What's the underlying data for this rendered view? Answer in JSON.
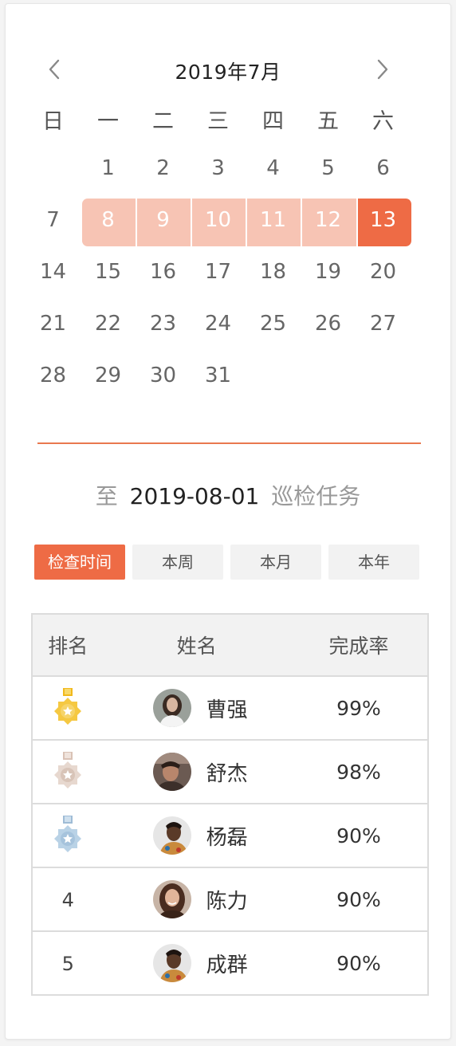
{
  "calendar": {
    "title": "2019年7月",
    "weekdays": [
      "日",
      "一",
      "二",
      "三",
      "四",
      "五",
      "六"
    ],
    "days": [
      "1",
      "2",
      "3",
      "4",
      "5",
      "6",
      "7",
      "8",
      "9",
      "10",
      "11",
      "12",
      "13",
      "14",
      "15",
      "16",
      "17",
      "18",
      "19",
      "20",
      "21",
      "22",
      "23",
      "24",
      "25",
      "26",
      "27",
      "28",
      "29",
      "30",
      "31"
    ],
    "selected_range": [
      "8",
      "13"
    ],
    "selected_end_day": "13"
  },
  "range": {
    "prefix": "至",
    "date": "2019-08-01",
    "suffix": "巡检任务"
  },
  "filters": [
    {
      "label": "检查时间",
      "active": true
    },
    {
      "label": "本周",
      "active": false
    },
    {
      "label": "本月",
      "active": false
    },
    {
      "label": "本年",
      "active": false
    }
  ],
  "ranking": {
    "headers": {
      "rank": "排名",
      "name": "姓名",
      "rate": "完成率"
    },
    "rows": [
      {
        "rank": "1",
        "medal": "gold-medal-icon",
        "name": "曹强",
        "rate": "99%"
      },
      {
        "rank": "2",
        "medal": "silver-medal-icon",
        "name": "舒杰",
        "rate": "98%"
      },
      {
        "rank": "3",
        "medal": "bronze-medal-icon",
        "name": "杨磊",
        "rate": "90%"
      },
      {
        "rank": "4",
        "medal": null,
        "name": "陈力",
        "rate": "90%"
      },
      {
        "rank": "5",
        "medal": null,
        "name": "成群",
        "rate": "90%"
      }
    ]
  },
  "colors": {
    "accent": "#ee6b45",
    "range_fill": "#f7c4b4",
    "divider": "#e9784f",
    "gold": "#f5c842",
    "silver": "#e7d8cf",
    "bronze": "#b9d2e6"
  }
}
